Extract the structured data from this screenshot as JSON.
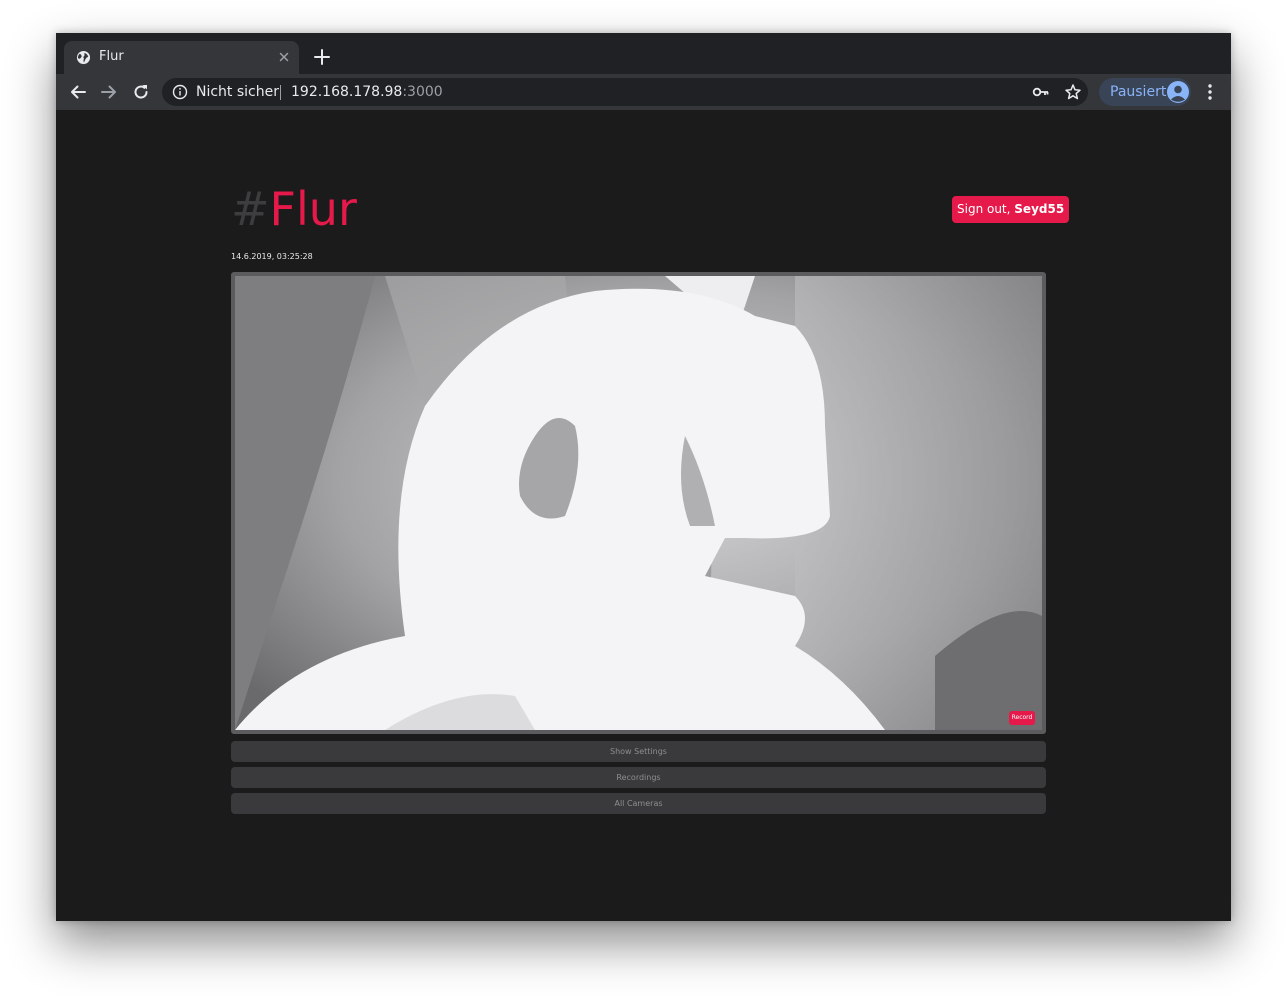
{
  "browser": {
    "tab": {
      "title": "Flur",
      "favicon": "globe-icon",
      "close_icon": "close-icon"
    },
    "new_tab_icon": "plus-icon",
    "toolbar": {
      "back_icon": "arrow-left-icon",
      "forward_icon": "arrow-right-icon",
      "reload_icon": "reload-icon",
      "security_label": "Nicht sicher",
      "url_host": "192.168.178.98",
      "url_port": ":3000",
      "key_icon": "key-icon",
      "bookmark_icon": "star-icon",
      "profile_label": "Pausiert",
      "menu_icon": "more-vert-icon"
    }
  },
  "page": {
    "title_prefix": "#",
    "title_name": "Flur",
    "signout_prefix": "Sign out, ",
    "signout_user": "Seyd55",
    "timestamp": "14.6.2019, 03:25:28",
    "record_label": "Record",
    "buttons": [
      {
        "label": "Show Settings"
      },
      {
        "label": "Recordings"
      },
      {
        "label": "All Cameras"
      }
    ]
  },
  "colors": {
    "accent": "#e5194a",
    "page_bg": "#1b1b1c",
    "chrome_dark": "#202124",
    "chrome_toolbar": "#35363a",
    "button_bg": "#3a3a3c"
  }
}
